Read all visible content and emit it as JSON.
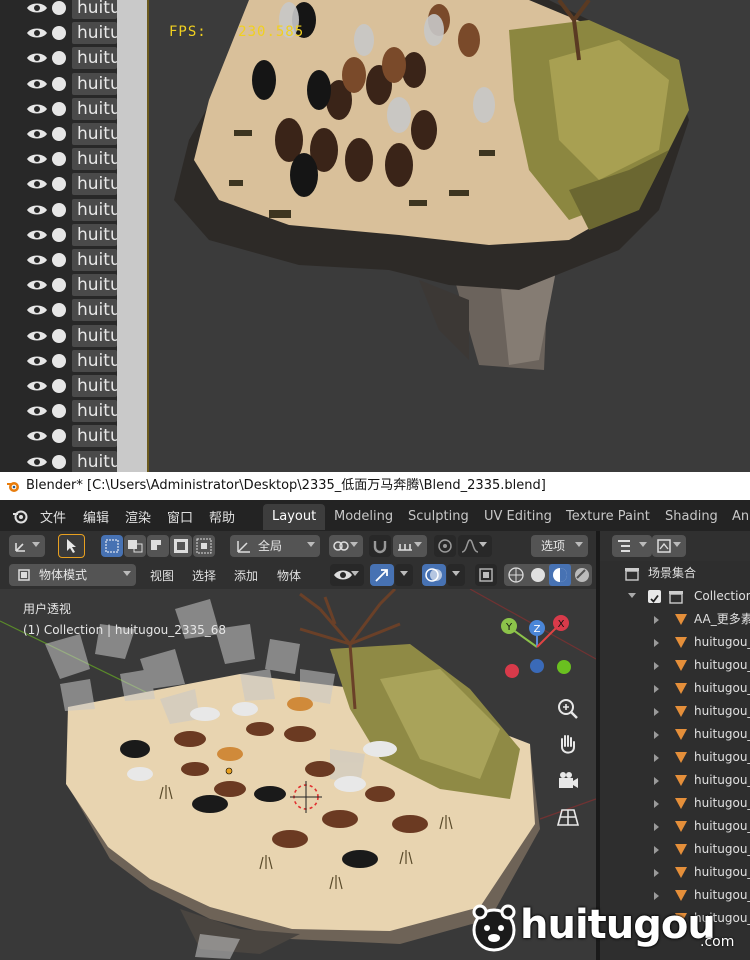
{
  "top_panel": {
    "fps_label": "FPS:",
    "fps_value": "230.585",
    "outliner_rows": [
      "huitu",
      "huitu",
      "huitu",
      "huitu",
      "huitu",
      "huitu",
      "huitu",
      "huitu",
      "huitu",
      "huitu",
      "huitu",
      "huitu",
      "huitu",
      "huitu",
      "huitu",
      "huitu",
      "huitu",
      "huitu",
      "huitu"
    ]
  },
  "titlebar": {
    "text": "Blender* [C:\\Users\\Administrator\\Desktop\\2335_低面万马奔腾\\Blend_2335.blend]"
  },
  "menubar": {
    "items": [
      "文件",
      "编辑",
      "渲染",
      "窗口",
      "帮助"
    ],
    "tabs": [
      "Layout",
      "Modeling",
      "Sculpting",
      "UV Editing",
      "Texture Paint",
      "Shading",
      "Ani"
    ],
    "active_tab": "Layout"
  },
  "header": {
    "orientation": "全局",
    "options": "选项",
    "mode": "物体模式",
    "menus": [
      "视图",
      "选择",
      "添加",
      "物体"
    ]
  },
  "viewport": {
    "view_name": "用户透视",
    "collection_info": "(1) Collection | huitugou_2335_68",
    "gizmo": {
      "x": "X",
      "y": "Y",
      "z": "Z"
    }
  },
  "outliner": {
    "scene_collection": "场景集合",
    "collection": "Collection",
    "items": [
      "AA_更多素",
      "huitugou_",
      "huitugou_",
      "huitugou_",
      "huitugou_",
      "huitugou_",
      "huitugou_",
      "huitugou_",
      "huitugou_",
      "huitugou_",
      "huitugou_",
      "huitugou_",
      "huitugou_",
      "huitugou_"
    ]
  },
  "watermark": {
    "text": "huitugou",
    "suffix": ".com"
  },
  "colors": {
    "accent_blue": "#4772b3",
    "fps_yellow": "#f0d020",
    "object_orange": "#e58f3a"
  }
}
